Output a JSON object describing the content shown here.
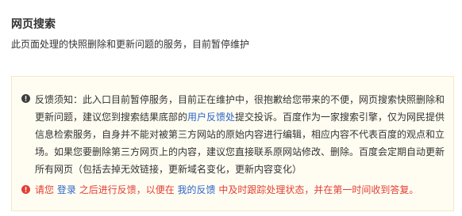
{
  "page": {
    "title": "网页搜索",
    "subtitle": "此页面处理的快照删除和更新问题的服务，目前暂停维护"
  },
  "notice": {
    "info_part1": "反馈须知：此入口目前暂停服务，目前正在维护中，很抱歉给您带来的不便，网页搜索快照删除和更新问题，建议您到搜索结果底部的",
    "info_link": "用户反馈处",
    "info_part2": "提交投诉。百度作为一家搜索引擎，仅为网民提供信息检索服务，自身并不能对被第三方网站的原始内容进行编辑，相应内容不代表百度的观点和立场。如果您要删除第三方网页上的内容，建议您直接联系原网站修改、删除。百度会定期自动更新所有网页（包括去掉无效链接，更新域名变化，更新内容变化）",
    "warn_part1": "请您",
    "login_link": "登录",
    "warn_part2": "之后进行反馈，以便在",
    "my_feedback_link": "我的反馈",
    "warn_part3": "中及时跟踪处理状态，并在第一时间收到答复。"
  },
  "colors": {
    "link": "#2f66c8",
    "warning": "#e33e33",
    "notice_bg": "#fffdf2",
    "notice_border": "#f3e9c4"
  },
  "icons": {
    "info": "exclamation-circle-icon",
    "warning": "exclamation-circle-icon"
  }
}
